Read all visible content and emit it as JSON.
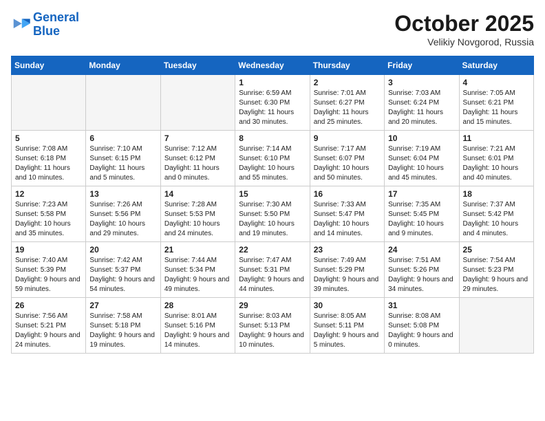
{
  "logo": {
    "line1": "General",
    "line2": "Blue"
  },
  "title": "October 2025",
  "subtitle": "Velikiy Novgorod, Russia",
  "weekdays": [
    "Sunday",
    "Monday",
    "Tuesday",
    "Wednesday",
    "Thursday",
    "Friday",
    "Saturday"
  ],
  "weeks": [
    [
      {
        "day": "",
        "empty": true
      },
      {
        "day": "",
        "empty": true
      },
      {
        "day": "",
        "empty": true
      },
      {
        "day": "1",
        "sunrise": "6:59 AM",
        "sunset": "6:30 PM",
        "daylight": "11 hours and 30 minutes."
      },
      {
        "day": "2",
        "sunrise": "7:01 AM",
        "sunset": "6:27 PM",
        "daylight": "11 hours and 25 minutes."
      },
      {
        "day": "3",
        "sunrise": "7:03 AM",
        "sunset": "6:24 PM",
        "daylight": "11 hours and 20 minutes."
      },
      {
        "day": "4",
        "sunrise": "7:05 AM",
        "sunset": "6:21 PM",
        "daylight": "11 hours and 15 minutes."
      }
    ],
    [
      {
        "day": "5",
        "sunrise": "7:08 AM",
        "sunset": "6:18 PM",
        "daylight": "11 hours and 10 minutes."
      },
      {
        "day": "6",
        "sunrise": "7:10 AM",
        "sunset": "6:15 PM",
        "daylight": "11 hours and 5 minutes."
      },
      {
        "day": "7",
        "sunrise": "7:12 AM",
        "sunset": "6:12 PM",
        "daylight": "11 hours and 0 minutes."
      },
      {
        "day": "8",
        "sunrise": "7:14 AM",
        "sunset": "6:10 PM",
        "daylight": "10 hours and 55 minutes."
      },
      {
        "day": "9",
        "sunrise": "7:17 AM",
        "sunset": "6:07 PM",
        "daylight": "10 hours and 50 minutes."
      },
      {
        "day": "10",
        "sunrise": "7:19 AM",
        "sunset": "6:04 PM",
        "daylight": "10 hours and 45 minutes."
      },
      {
        "day": "11",
        "sunrise": "7:21 AM",
        "sunset": "6:01 PM",
        "daylight": "10 hours and 40 minutes."
      }
    ],
    [
      {
        "day": "12",
        "sunrise": "7:23 AM",
        "sunset": "5:58 PM",
        "daylight": "10 hours and 35 minutes."
      },
      {
        "day": "13",
        "sunrise": "7:26 AM",
        "sunset": "5:56 PM",
        "daylight": "10 hours and 29 minutes."
      },
      {
        "day": "14",
        "sunrise": "7:28 AM",
        "sunset": "5:53 PM",
        "daylight": "10 hours and 24 minutes."
      },
      {
        "day": "15",
        "sunrise": "7:30 AM",
        "sunset": "5:50 PM",
        "daylight": "10 hours and 19 minutes."
      },
      {
        "day": "16",
        "sunrise": "7:33 AM",
        "sunset": "5:47 PM",
        "daylight": "10 hours and 14 minutes."
      },
      {
        "day": "17",
        "sunrise": "7:35 AM",
        "sunset": "5:45 PM",
        "daylight": "10 hours and 9 minutes."
      },
      {
        "day": "18",
        "sunrise": "7:37 AM",
        "sunset": "5:42 PM",
        "daylight": "10 hours and 4 minutes."
      }
    ],
    [
      {
        "day": "19",
        "sunrise": "7:40 AM",
        "sunset": "5:39 PM",
        "daylight": "9 hours and 59 minutes."
      },
      {
        "day": "20",
        "sunrise": "7:42 AM",
        "sunset": "5:37 PM",
        "daylight": "9 hours and 54 minutes."
      },
      {
        "day": "21",
        "sunrise": "7:44 AM",
        "sunset": "5:34 PM",
        "daylight": "9 hours and 49 minutes."
      },
      {
        "day": "22",
        "sunrise": "7:47 AM",
        "sunset": "5:31 PM",
        "daylight": "9 hours and 44 minutes."
      },
      {
        "day": "23",
        "sunrise": "7:49 AM",
        "sunset": "5:29 PM",
        "daylight": "9 hours and 39 minutes."
      },
      {
        "day": "24",
        "sunrise": "7:51 AM",
        "sunset": "5:26 PM",
        "daylight": "9 hours and 34 minutes."
      },
      {
        "day": "25",
        "sunrise": "7:54 AM",
        "sunset": "5:23 PM",
        "daylight": "9 hours and 29 minutes."
      }
    ],
    [
      {
        "day": "26",
        "sunrise": "7:56 AM",
        "sunset": "5:21 PM",
        "daylight": "9 hours and 24 minutes."
      },
      {
        "day": "27",
        "sunrise": "7:58 AM",
        "sunset": "5:18 PM",
        "daylight": "9 hours and 19 minutes."
      },
      {
        "day": "28",
        "sunrise": "8:01 AM",
        "sunset": "5:16 PM",
        "daylight": "9 hours and 14 minutes."
      },
      {
        "day": "29",
        "sunrise": "8:03 AM",
        "sunset": "5:13 PM",
        "daylight": "9 hours and 10 minutes."
      },
      {
        "day": "30",
        "sunrise": "8:05 AM",
        "sunset": "5:11 PM",
        "daylight": "9 hours and 5 minutes."
      },
      {
        "day": "31",
        "sunrise": "8:08 AM",
        "sunset": "5:08 PM",
        "daylight": "9 hours and 0 minutes."
      },
      {
        "day": "",
        "empty": true
      }
    ]
  ],
  "labels": {
    "sunrise": "Sunrise:",
    "sunset": "Sunset:",
    "daylight": "Daylight:"
  }
}
